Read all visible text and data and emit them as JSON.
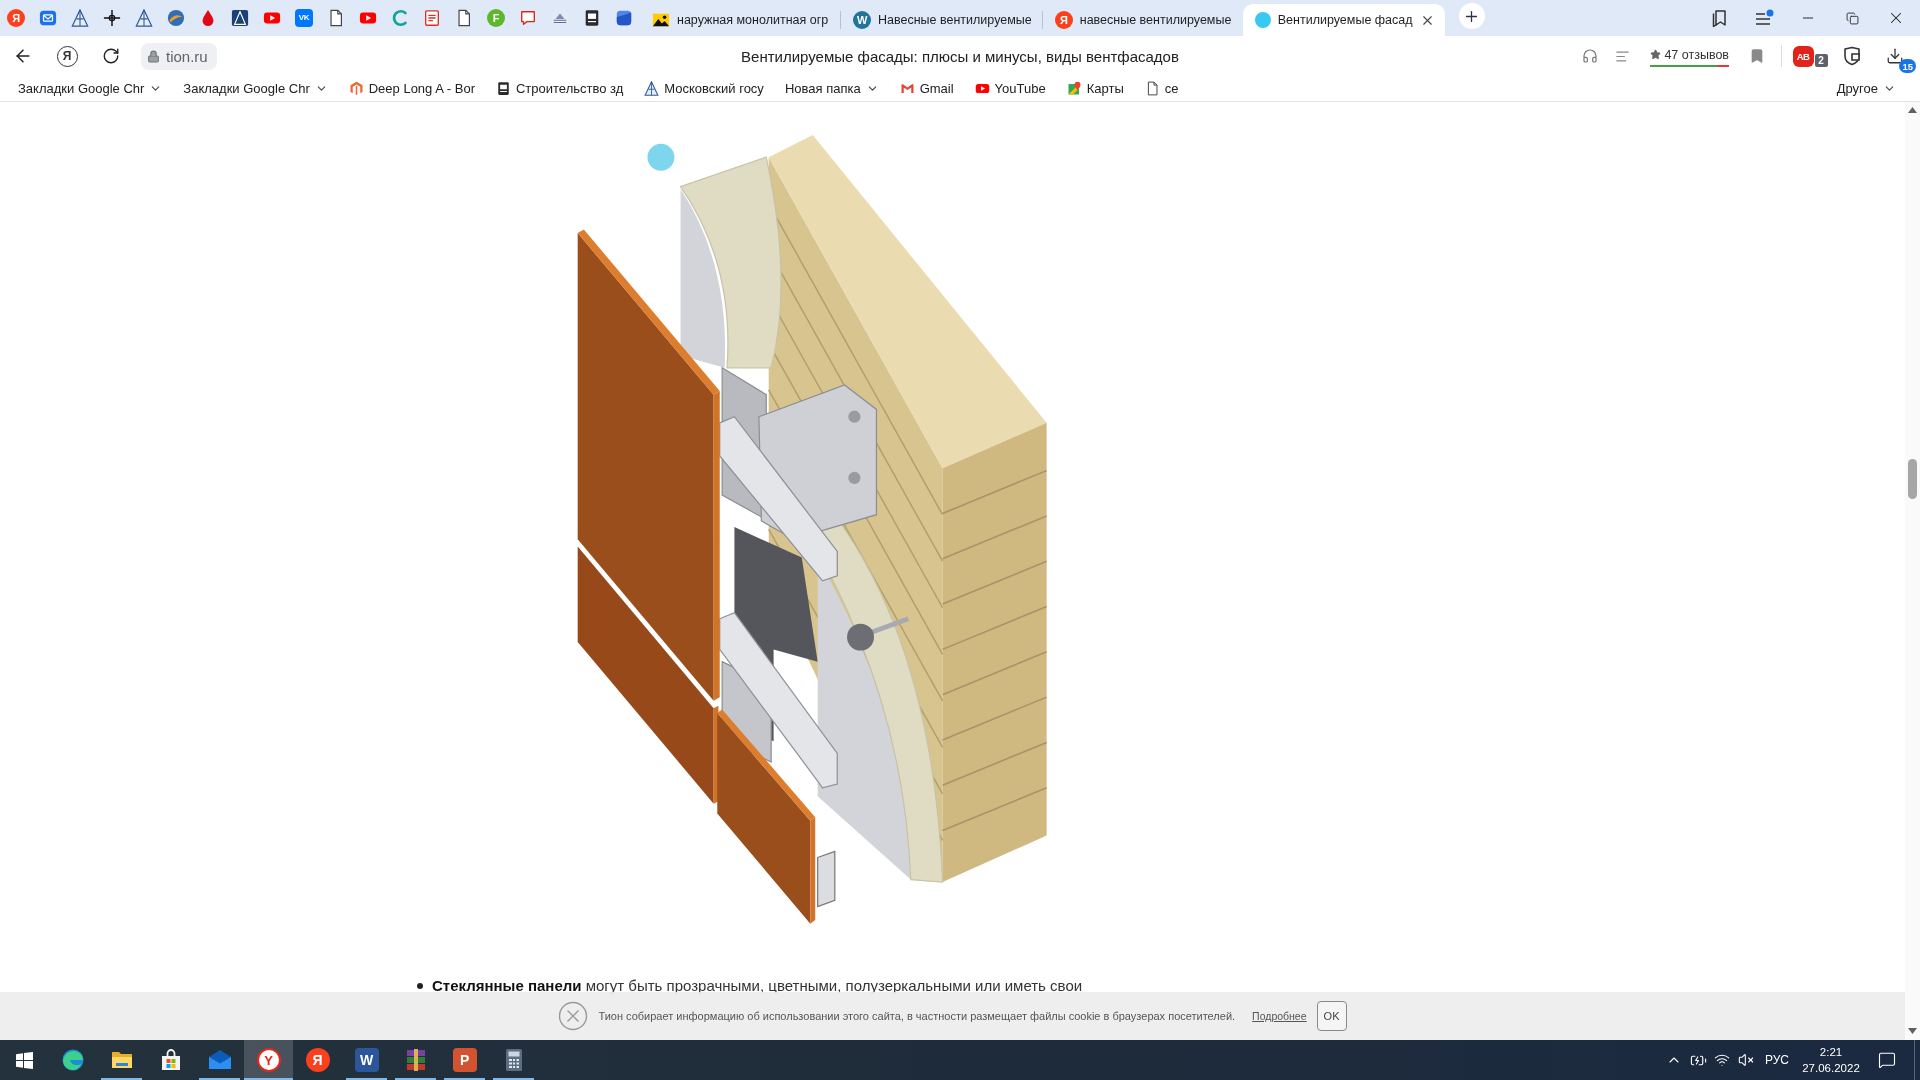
{
  "tab_bar": {
    "pinned_tabs": [
      {
        "kind": "circle",
        "glyph": "Я",
        "color": "#fc3f1d"
      },
      {
        "kind": "mail"
      },
      {
        "kind": "pyramid"
      },
      {
        "kind": "crosshair"
      },
      {
        "kind": "pyramid"
      },
      {
        "kind": "disc"
      },
      {
        "kind": "drop"
      },
      {
        "kind": "tile"
      },
      {
        "kind": "video"
      },
      {
        "kind": "square",
        "glyph": "VK",
        "color": "#0077ff"
      },
      {
        "kind": "page"
      },
      {
        "kind": "video"
      },
      {
        "kind": "arc"
      },
      {
        "kind": "document"
      },
      {
        "kind": "page"
      },
      {
        "kind": "circle",
        "glyph": "F",
        "color": "#5cb82a"
      },
      {
        "kind": "chat"
      },
      {
        "kind": "building"
      },
      {
        "kind": "slides"
      },
      {
        "kind": "cube"
      }
    ],
    "tabs": [
      {
        "title": "наружная монолитная огр",
        "kind": "photo",
        "selected": false
      },
      {
        "title": "Навесные вентилируемые",
        "kind": "circle",
        "glyph": "W",
        "color": "#21759b",
        "selected": false
      },
      {
        "title": "навесные вентилируемые",
        "kind": "circle",
        "glyph": "Я",
        "color": "#fc3f1d",
        "selected": false
      },
      {
        "title": "Вентилируемые фасад",
        "kind": "dot",
        "color": "#38c8f2",
        "selected": true
      }
    ]
  },
  "address_bar": {
    "home_glyph": "Я",
    "url": "tion.ru",
    "title": "Вентилируемые фасады: плюсы и минусы, виды вентфасадов",
    "reviews": {
      "label": "47 отзывов",
      "level": 0.85
    },
    "adblock": {
      "glyph": "AB",
      "badge": "2"
    },
    "downloads_badge": "15"
  },
  "bookmarks_bar": {
    "items": [
      {
        "label": "Закладки Google Chr",
        "kind": "folder"
      },
      {
        "label": "Закладки Google Chr",
        "kind": "folder"
      },
      {
        "label": "Deep Long A - Bor",
        "kind": "hexagon"
      },
      {
        "label": "Строительство зд",
        "kind": "slides"
      },
      {
        "label": "Московский госу",
        "kind": "pyramid"
      },
      {
        "label": "Новая папка",
        "kind": "folder"
      },
      {
        "label": "Gmail",
        "kind": "envelope"
      },
      {
        "label": "YouTube",
        "kind": "video"
      },
      {
        "label": "Карты",
        "kind": "map"
      },
      {
        "label": "се",
        "kind": "page"
      }
    ],
    "other": "Другое"
  },
  "article": {
    "bullets": [
      "**Стеклянные панели** могут быть прозрачными, цветными, полузеркальными или иметь свои"
    ]
  },
  "cookie_banner": {
    "text": "Тион собирает информацию об использовании этого сайта, в частности размещает файлы cookie в браузерах посетителей.",
    "link": "Подробнее",
    "button": "OK"
  },
  "taskbar": {
    "apps": [
      {
        "kind": "swirl",
        "running": false,
        "selected": false
      },
      {
        "kind": "folder",
        "running": true,
        "selected": false
      },
      {
        "kind": "bag",
        "running": false,
        "selected": false
      },
      {
        "kind": "mail",
        "running": true,
        "selected": false
      },
      {
        "kind": "ring",
        "glyph": "Y",
        "color": "#e5261a",
        "running": true,
        "selected": true
      },
      {
        "kind": "circle",
        "glyph": "Я",
        "color": "#fc3f1d",
        "running": false,
        "selected": false
      },
      {
        "kind": "square",
        "glyph": "W",
        "color": "#2b579a",
        "running": true,
        "selected": false
      },
      {
        "kind": "books",
        "running": true,
        "selected": false
      },
      {
        "kind": "square",
        "glyph": "P",
        "color": "#d35230",
        "running": true,
        "selected": false
      },
      {
        "kind": "calculator",
        "running": true,
        "selected": false
      }
    ],
    "tray": {
      "language": "РУС",
      "time": "2:21",
      "date": "27.06.2022"
    }
  }
}
